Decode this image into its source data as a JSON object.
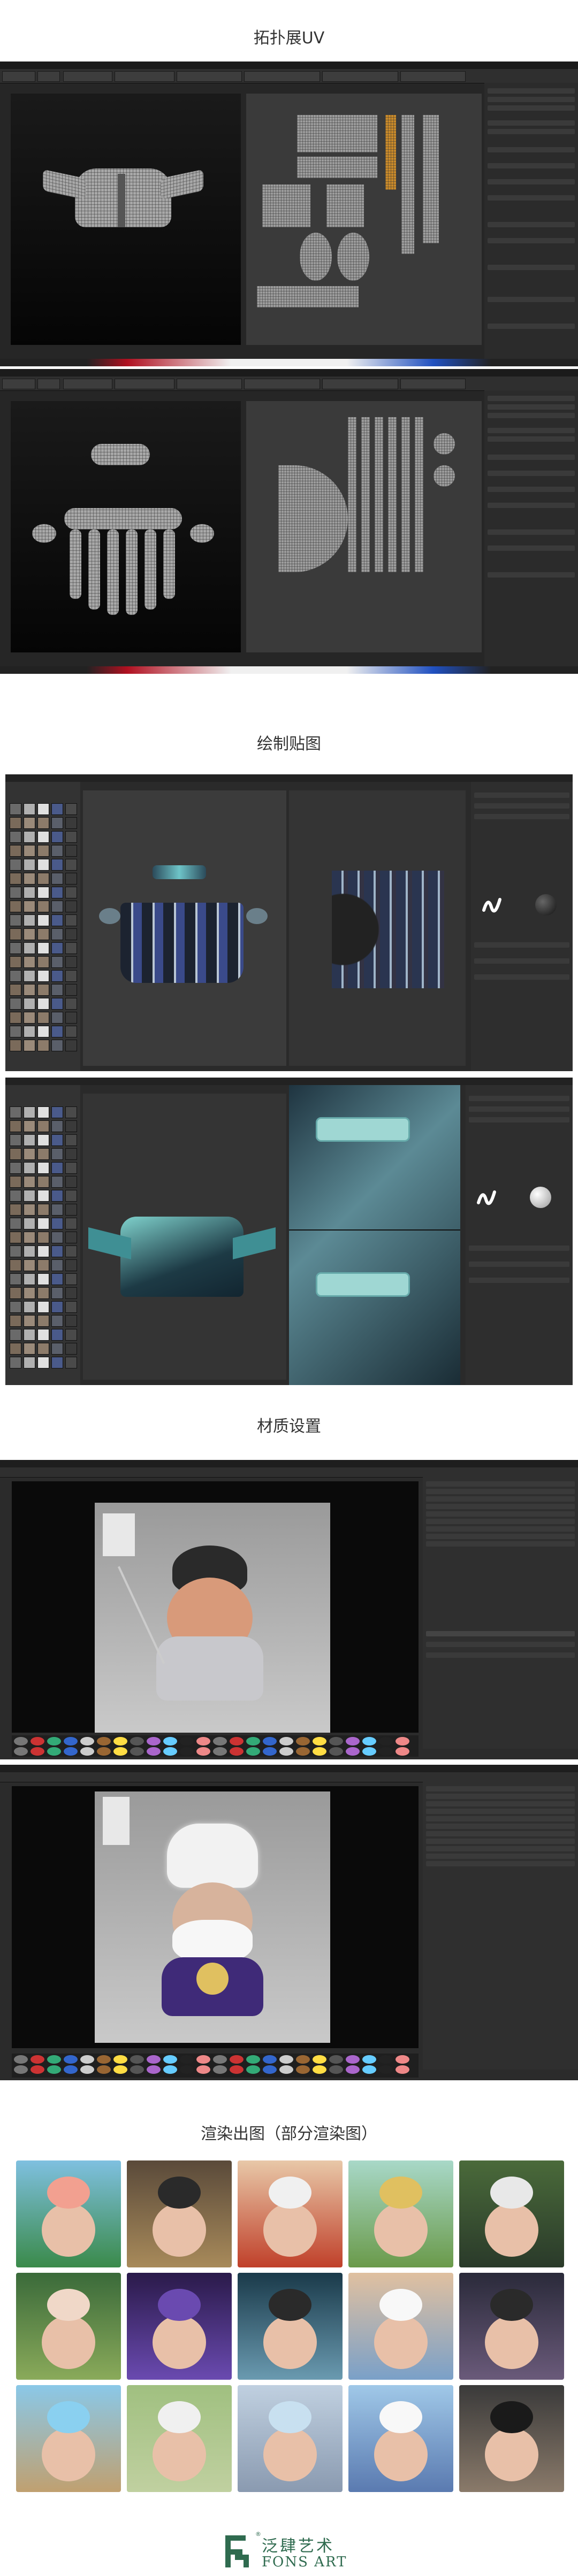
{
  "sections": {
    "uv": "拓扑展UV",
    "paint": "绘制贴图",
    "material": "材质设置",
    "render": "渲染出图（部分渲染图）"
  },
  "brand": {
    "name_cn": "泛肆艺术",
    "name_en": "FONS ART",
    "mark": "®",
    "color": "#2f6b4f"
  },
  "icons": [
    "viewport-icon",
    "brush-icon",
    "material-ball-icon",
    "logo-icon"
  ]
}
